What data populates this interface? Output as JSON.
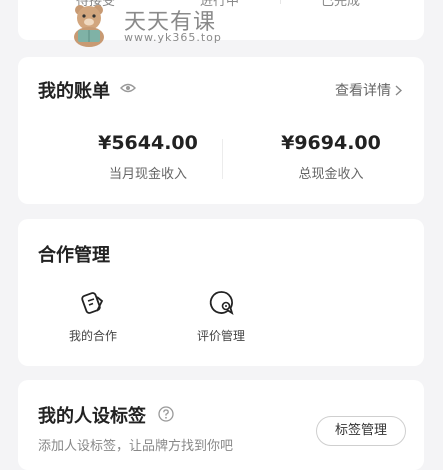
{
  "top_tabs": [
    "待接受",
    "进行中",
    "已完成"
  ],
  "watermark": {
    "title": "天天有课",
    "subtitle": "www.yk365.top"
  },
  "bill": {
    "title": "我的账单",
    "detail_link": "查看详情",
    "monthly_amount": "¥5644.00",
    "monthly_label": "当月现金收入",
    "total_amount": "¥9694.00",
    "total_label": "总现金收入"
  },
  "cooperation": {
    "title": "合作管理",
    "items": [
      {
        "label": "我的合作",
        "icon": "cooperation-icon"
      },
      {
        "label": "评价管理",
        "icon": "review-icon"
      }
    ]
  },
  "persona_tags": {
    "title": "我的人设标签",
    "description": "添加人设标签，让品牌方找到你吧",
    "button": "标签管理"
  }
}
